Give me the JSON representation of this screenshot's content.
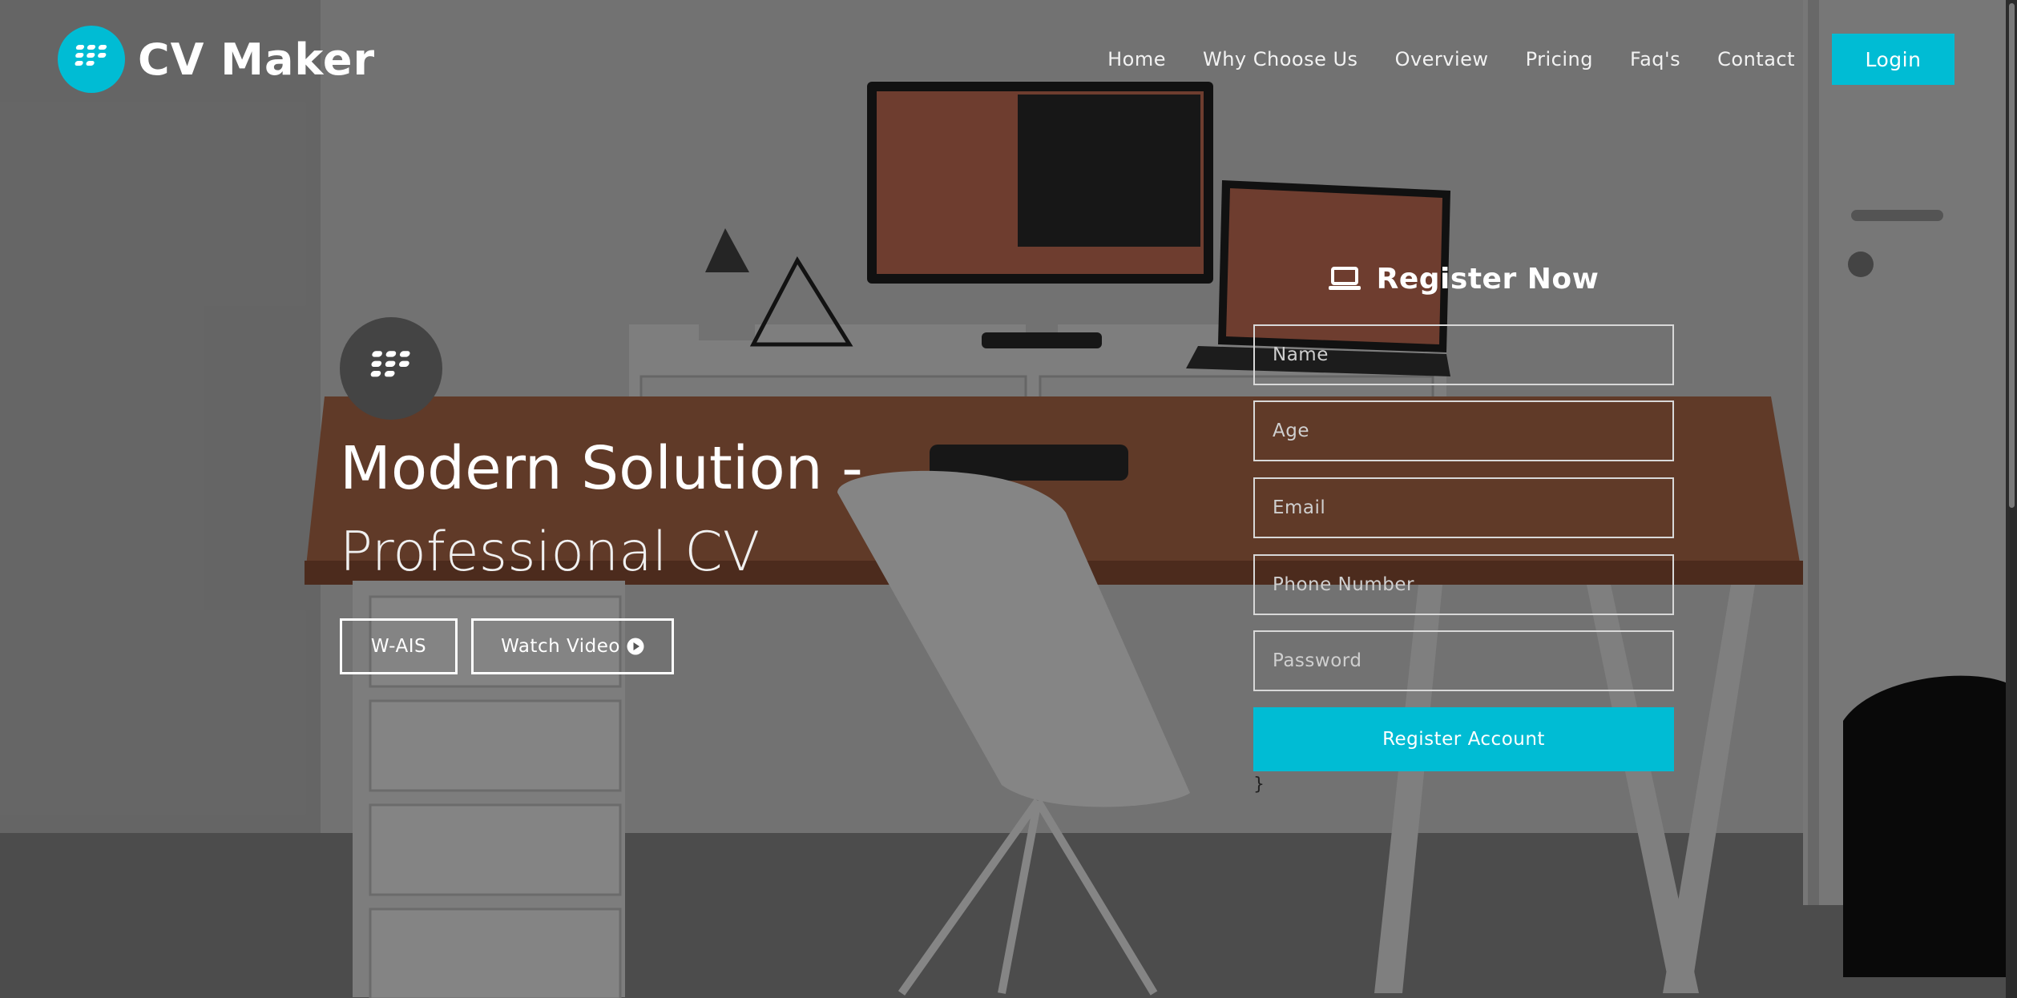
{
  "brand": {
    "name": "CV Maker",
    "accent_color": "#00bcd4",
    "logo_icon": "blackberry-icon"
  },
  "nav": {
    "items": [
      "Home",
      "Why Choose Us",
      "Overview",
      "Pricing",
      "Faq's",
      "Contact"
    ],
    "login_label": "Login"
  },
  "hero": {
    "icon": "blackberry-icon",
    "title": "Modern Solution -",
    "subtitle": "Professional CV",
    "buttons": {
      "primary_label": "W-AIS",
      "video_label": "Watch Video",
      "video_icon": "play-circle-icon"
    }
  },
  "register": {
    "title": "Register Now",
    "title_icon": "laptop-icon",
    "fields": {
      "name_placeholder": "Name",
      "age_placeholder": "Age",
      "email_placeholder": "Email",
      "phone_placeholder": "Phone Number",
      "password_placeholder": "Password"
    },
    "submit_label": "Register Account",
    "stray_text": "}"
  }
}
